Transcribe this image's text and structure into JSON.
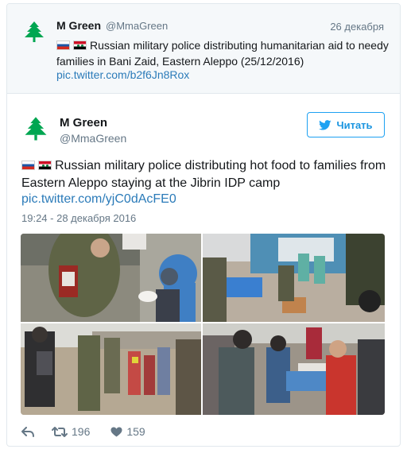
{
  "quoted": {
    "name": "M Green",
    "handle": "@MmaGreen",
    "date": "26 декабря",
    "text": "Russian military police distributing humanitarian aid to needy families in Bani Zaid, Eastern Aleppo (25/12/2016)",
    "link": "pic.twitter.com/b2f6Jn8Rox"
  },
  "tweet": {
    "name": "M Green",
    "handle": "@MmaGreen",
    "follow_label": "Читать",
    "text": "Russian military police distributing hot food to families from Eastern Aleppo staying at the Jibrin IDP camp",
    "link": "pic.twitter.com/yjC0dAcFE0",
    "timestamp": "19:24 - 28 декабря 2016",
    "retweets": "196",
    "likes": "159"
  },
  "photos": [
    {
      "caption": "soldier-with-child"
    },
    {
      "caption": "tents-and-food-table"
    },
    {
      "caption": "crowd-waiting"
    },
    {
      "caption": "children-with-food"
    }
  ],
  "icons": {
    "avatar": "lebanon-cedar-icon",
    "flag_1": "russia-flag-icon",
    "flag_2": "syria-flag-icon",
    "follow": "twitter-bird-icon",
    "reply": "reply-icon",
    "retweet": "retweet-icon",
    "like": "heart-icon"
  },
  "colors": {
    "link": "#2b7bb9",
    "accent": "#1da1f2",
    "muted": "#657786",
    "cedar": "#00a651"
  }
}
